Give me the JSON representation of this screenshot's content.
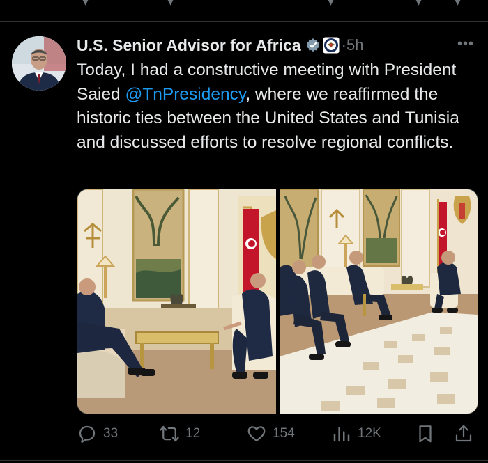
{
  "tweet": {
    "author_name": "U.S. Senior Advisor for Africa",
    "separator": "·",
    "timestamp": "5h",
    "text_before_mention": "Today, I had a constructive meeting with President Saied ",
    "mention": "@TnPresidency",
    "text_after_mention": ", where we reaffirmed the historic ties between the United States and Tunisia and discussed efforts to resolve regional conflicts."
  },
  "media": {
    "images": [
      {
        "name": "meeting-photo-left",
        "description_icon": "photo-icon"
      },
      {
        "name": "meeting-photo-right",
        "description_icon": "photo-icon"
      }
    ]
  },
  "actions": {
    "reply_count": "33",
    "retweet_count": "12",
    "like_count": "154",
    "view_count": "12K"
  },
  "icons": {
    "verified": "verified-badge-icon",
    "affiliate": "state-department-seal-icon",
    "more": "more-options-icon",
    "reply": "reply-icon",
    "retweet": "retweet-icon",
    "like": "heart-icon",
    "views": "views-icon",
    "bookmark": "bookmark-icon",
    "share": "share-icon"
  },
  "colors": {
    "background": "#000000",
    "text": "#e7e9ea",
    "muted": "#71767b",
    "accent": "#1d9bf0"
  }
}
